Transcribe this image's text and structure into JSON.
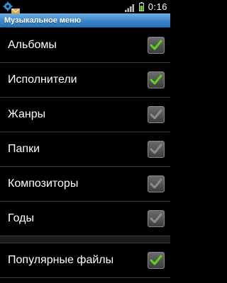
{
  "status_bar": {
    "time": "0:16",
    "icons": [
      "gear-notification-icon",
      "mail-icon",
      "signal-icon",
      "battery-icon"
    ]
  },
  "title_bar": {
    "title": "Музыкальное меню"
  },
  "list": {
    "items": [
      {
        "label": "Альбомы",
        "checked": true,
        "enabled": true
      },
      {
        "label": "Исполнители",
        "checked": true,
        "enabled": true
      },
      {
        "label": "Жанры",
        "checked": true,
        "enabled": false
      },
      {
        "label": "Папки",
        "checked": true,
        "enabled": false
      },
      {
        "label": "Композиторы",
        "checked": true,
        "enabled": false
      },
      {
        "label": "Годы",
        "checked": true,
        "enabled": false
      }
    ],
    "extra_items": [
      {
        "label": "Популярные файлы",
        "checked": true,
        "enabled": true
      }
    ]
  },
  "colors": {
    "check_active": "#5fd21e",
    "check_disabled": "#8c8c8c",
    "title_bar": "#3c86c9"
  }
}
